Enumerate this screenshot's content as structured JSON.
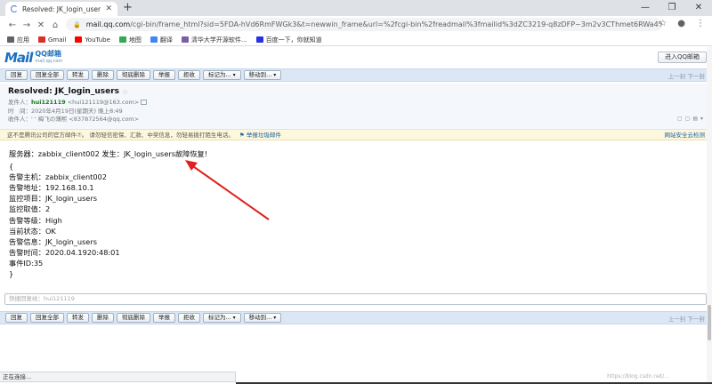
{
  "browser": {
    "tab_title": "Resolved: JK_login_users - QQ",
    "url_host": "mail.qq.com",
    "url_path": "/cgi-bin/frame_html?sid=5FDA-hVd6RmFWGk3&t=newwin_frame&url=%2fcgi-bin%2freadmail%3fmailid%3dZC3219-q8zDFP~3m2v3CThmet6RWa4%26need_textcontent...",
    "bookmarks": [
      {
        "label": "应用",
        "color": "#5f6368"
      },
      {
        "label": "Gmail",
        "color": "#d93025"
      },
      {
        "label": "YouTube",
        "color": "#ff0000"
      },
      {
        "label": "地图",
        "color": "#34a853"
      },
      {
        "label": "翻译",
        "color": "#4285f4"
      },
      {
        "label": "清华大学开源软件...",
        "color": "#7b5ea7"
      },
      {
        "label": "百度一下，你就知道",
        "color": "#2932e1"
      }
    ]
  },
  "header": {
    "logo_main": "Mail",
    "logo_cn": "QQ邮箱",
    "logo_sub": "mail.qq.com",
    "enter_qq": "进入QQ邮箱"
  },
  "toolbar": {
    "buttons": [
      "回复",
      "回复全部",
      "转发",
      "删除",
      "彻底删除",
      "举报",
      "拒收"
    ],
    "mark_as": "标记为...",
    "move_to": "移动到...",
    "pager": "上一封 下一封"
  },
  "mail": {
    "subject": "Resolved: JK_login_users",
    "from_label": "发件人：",
    "from_name": "hui121119",
    "from_addr": "<hui121119@163.com>",
    "time_label": "时　间：",
    "time_value": "2020年4月19日(星期天) 晚上8:49",
    "to_label": "收件人：",
    "to_value": "' ' 梅飞の薄熙 <837872564@qq.com>",
    "warning": "这不是腾讯公司的官方邮件⑦。 请勿轻信密保、汇款、中奖信息，勿轻易拨打陌生电话。",
    "report": "举报垃圾邮件",
    "security_link": "网站安全云检测",
    "body_first": "服务器：zabbix_client002 发生：JK_login_users故障恢复!",
    "body_lines": [
      "{",
      "告警主机：zabbix_client002",
      "告警地址：192.168.10.1",
      "监控项目：JK_login_users",
      "监控取值：2",
      "告警等级：High",
      "当前状态：OK",
      "告警信息：JK_login_users",
      "告警时间：2020.04.1920:48:01",
      "事件ID:35",
      "}"
    ],
    "reply_placeholder": "快捷回复给：hui121119"
  },
  "status_text": "正在连接...",
  "watermark": "https://blog.csdn.net/..."
}
